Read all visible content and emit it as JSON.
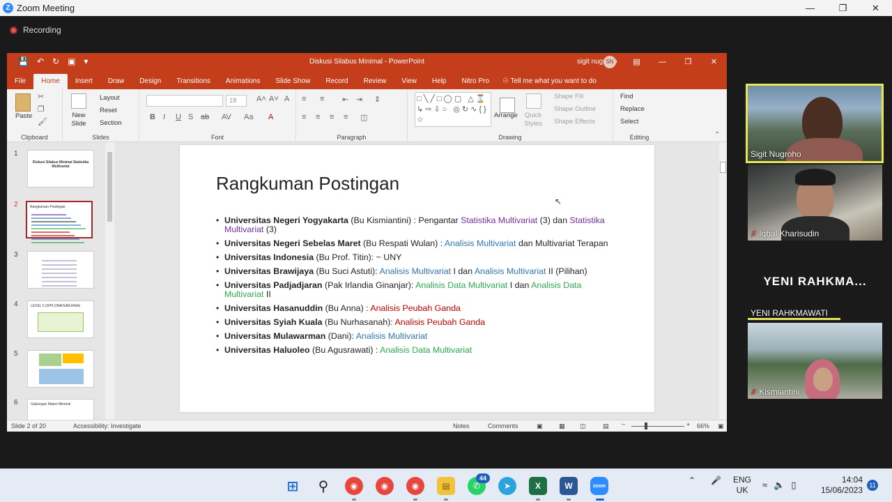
{
  "zoom": {
    "title": "Zoom Meeting",
    "logo": "Z",
    "recording_label": "Recording"
  },
  "ppt": {
    "title": "Diskusi Silabus Minimal  -  PowerPoint",
    "user_name": "sigit nugroho",
    "user_initials": "SN",
    "tabs": [
      "File",
      "Home",
      "Insert",
      "Draw",
      "Design",
      "Transitions",
      "Animations",
      "Slide Show",
      "Record",
      "Review",
      "View",
      "Help",
      "Nitro Pro"
    ],
    "tell_me": "Tell me what you want to do",
    "ribbon": {
      "clipboard": {
        "label": "Clipboard",
        "paste": "Paste"
      },
      "slides": {
        "label": "Slides",
        "new_slide": "New Slide",
        "layout": "Layout",
        "reset": "Reset",
        "section": "Section"
      },
      "font": {
        "label": "Font",
        "size": "18"
      },
      "paragraph": {
        "label": "Paragraph"
      },
      "drawing": {
        "label": "Drawing",
        "arrange": "Arrange",
        "quick_styles": "Quick Styles",
        "shape_fill": "Shape Fill",
        "shape_outline": "Shape Outline",
        "shape_effects": "Shape Effects"
      },
      "editing": {
        "label": "Editing",
        "find": "Find",
        "replace": "Replace",
        "select": "Select"
      }
    },
    "thumbnails": [
      {
        "num": "1",
        "text": "Diskusi Silabus Minimal Statistika Multivariat"
      },
      {
        "num": "2",
        "text": "Rangkuman Postingan"
      },
      {
        "num": "3",
        "text": ""
      },
      {
        "num": "4",
        "text": "LEVEL 6 (DIPLOMA/SARJANA)"
      },
      {
        "num": "5",
        "text": ""
      },
      {
        "num": "6",
        "text": "Gabungan Materi Minimal"
      }
    ],
    "slide": {
      "title": "Rangkuman Postingan",
      "items": [
        {
          "uni": "Universitas Negeri Yogyakarta",
          "pre": " (Bu Kismiantini) : Pengantar ",
          "c1": "Statistika Multivariat",
          "mid": " (3) dan ",
          "c2": "Statistika Multivariat",
          "post": " (3)",
          "color": "purple"
        },
        {
          "uni": "Universitas Negeri Sebelas Maret",
          "pre": " (Bu Respati Wulan) : ",
          "c1": "Analisis Multivariat",
          "mid": " dan Multivariat Terapan",
          "c2": "",
          "post": "",
          "color": "blue"
        },
        {
          "uni": "Universitas Indonesia",
          "pre": " (Bu Prof. Titin): ~ UNY",
          "c1": "",
          "mid": "",
          "c2": "",
          "post": "",
          "color": "blue"
        },
        {
          "uni": "Universitas Brawijaya",
          "pre": " (Bu Suci Astuti): ",
          "c1": "Analisis Multivariat",
          "mid": " I  dan ",
          "c2": "Analisis Multivariat",
          "post": " II (Pilihan)",
          "color": "blue"
        },
        {
          "uni": "Universitas Padjadjaran",
          "pre": " (Pak Irlandia Ginanjar): ",
          "c1": "Analisis Data Multivariat",
          "mid": " I dan ",
          "c2": "Analisis Data Multivariat",
          "post": " II",
          "color": "green"
        },
        {
          "uni": "Universitas Hasanuddin",
          "pre": " (Bu Anna) : ",
          "c1": "Analisis Peubah Ganda",
          "mid": "",
          "c2": "",
          "post": "",
          "color": "red"
        },
        {
          "uni": "Universitas Syiah Kuala",
          "pre": " (Bu Nurhasanah): ",
          "c1": "Analisis Peubah Ganda",
          "mid": "",
          "c2": "",
          "post": "",
          "color": "red"
        },
        {
          "uni": "Universitas Mulawarman",
          "pre": " (Dani): ",
          "c1": "Analisis Multivariat",
          "mid": "",
          "c2": "",
          "post": "",
          "color": "blue"
        },
        {
          "uni": "Universitas Haluoleo",
          "pre": " (Bu Agusrawati) : ",
          "c1": "Analisis Data Multivariat",
          "mid": "",
          "c2": "",
          "post": "",
          "color": "green"
        }
      ]
    },
    "status": {
      "slide_count": "Slide 2 of 20",
      "accessibility": "Accessibility: Investigate",
      "notes": "Notes",
      "comments": "Comments",
      "zoom": "66%"
    }
  },
  "participants": [
    {
      "name": "Sigit Nugroho",
      "muted": false,
      "active": true
    },
    {
      "name": "Iqbal Kharisudin",
      "muted": true
    },
    {
      "name": "YENI RAHKMAWATI",
      "big": "YENI  RAHKMA...",
      "muted": false
    },
    {
      "name": "Kismiantini",
      "muted": true
    }
  ],
  "taskbar": {
    "whatsapp_badge": "44",
    "language_line1": "ENG",
    "language_line2": "UK",
    "time": "14:04",
    "date": "15/06/2023",
    "notifications": "11"
  },
  "colors": {
    "ppt_accent": "#c43e1c",
    "purple": "#7030a0",
    "blue": "#2e75b6",
    "green": "#2fa84f",
    "red": "#c00000",
    "active_speaker": "#e8e45a"
  }
}
